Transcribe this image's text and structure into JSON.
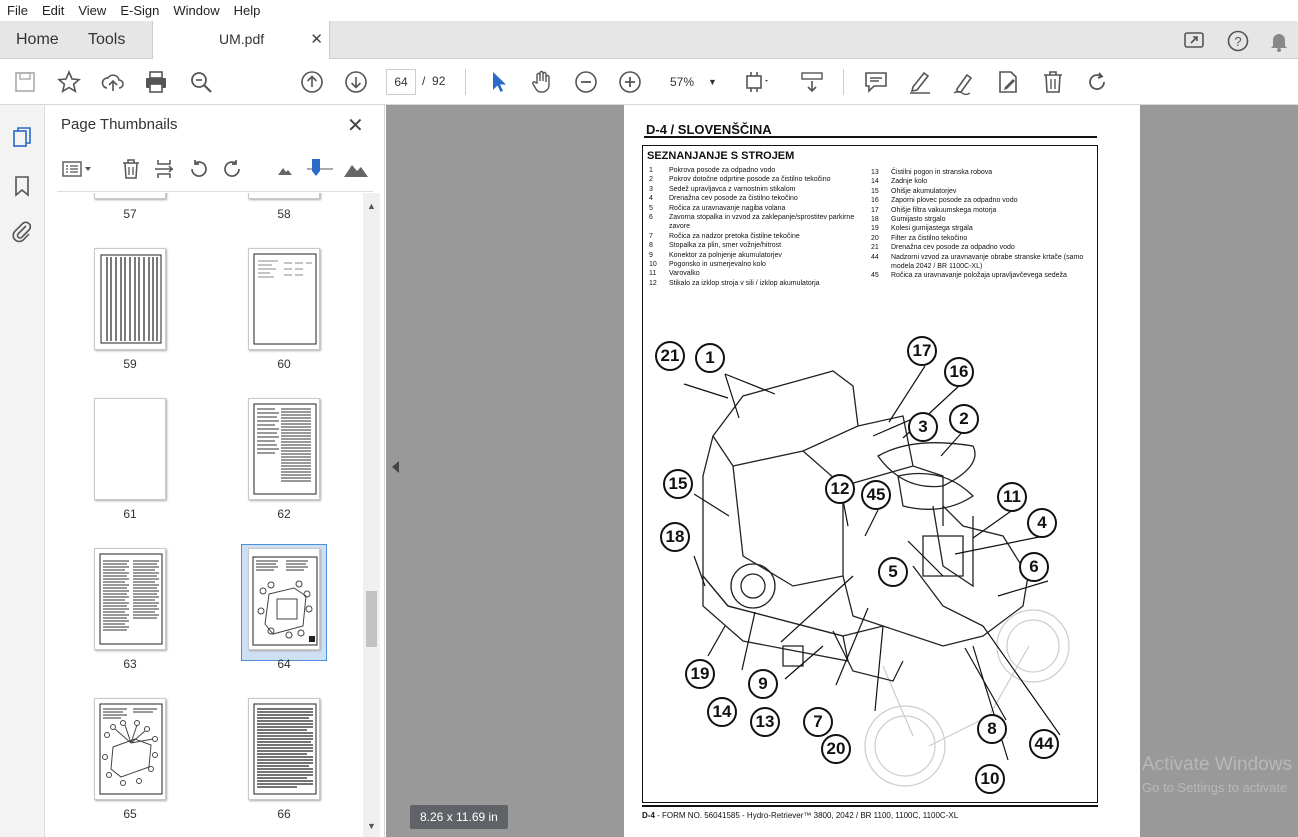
{
  "menu": [
    "File",
    "Edit",
    "View",
    "E-Sign",
    "Window",
    "Help"
  ],
  "tabs": {
    "home": "Home",
    "tools": "Tools",
    "document": "UM.pdf"
  },
  "toolbar": {
    "current_page": "64",
    "page_separator": "/",
    "total_pages": "92",
    "zoom": "57%"
  },
  "thumbnail_panel": {
    "title": "Page Thumbnails",
    "pages": [
      "57",
      "58",
      "59",
      "60",
      "61",
      "62",
      "63",
      "64",
      "65",
      "66"
    ],
    "selected_page": "64"
  },
  "page": {
    "header": "D-4 / SLOVENŠČINA",
    "section_title": "SEZNANJANJE S STROJEM",
    "legend_left": [
      {
        "n": "1",
        "t": "Pokrova posode za odpadno vodo"
      },
      {
        "n": "2",
        "t": "Pokrov dotočne odprtine posode za čistilno tekočino"
      },
      {
        "n": "3",
        "t": "Sedež upravljavca z varnostnim stikalom"
      },
      {
        "n": "4",
        "t": "Drenažna cev posode za čistilno tekočino"
      },
      {
        "n": "5",
        "t": "Ročica za uravnavanje nagiba volana"
      },
      {
        "n": "6",
        "t": "Zavorna stopalka in vzvod za zaklepanje/sprostitev parkirne zavore"
      },
      {
        "n": "7",
        "t": "Ročica za nadzor pretoka čistilne tekočine"
      },
      {
        "n": "8",
        "t": "Stopalka za plin, smer vožnje/hitrost"
      },
      {
        "n": "9",
        "t": "Konektor za polnjenje akumulatorjev"
      },
      {
        "n": "10",
        "t": "Pogonsko in usmerjevalno kolo"
      },
      {
        "n": "11",
        "t": "Varovalko"
      },
      {
        "n": "12",
        "t": "Stikalo za izklop stroja v sili / izklop akumulatorja"
      }
    ],
    "legend_right": [
      {
        "n": "13",
        "t": "Čistilni pogon in stranska robova"
      },
      {
        "n": "14",
        "t": "Zadnje kolo"
      },
      {
        "n": "15",
        "t": "Ohišje akumulatorjev"
      },
      {
        "n": "16",
        "t": "Zaporni plovec posode za odpadno vodo"
      },
      {
        "n": "17",
        "t": "Ohišje filtra vakuumskega motorja"
      },
      {
        "n": "18",
        "t": "Gumijasto strgalo"
      },
      {
        "n": "19",
        "t": "Kolesi gumijastega strgala"
      },
      {
        "n": "20",
        "t": "Filter za čistilno tekočino"
      },
      {
        "n": "21",
        "t": "Drenažna cev posode za odpadno vodo"
      },
      {
        "n": "44",
        "t": "Nadzorni vzvod za uravnavanje obrabe stranske krtače (samo modela 2042 / BR 1100C-XL)"
      },
      {
        "n": "45",
        "t": "Ročica za uravnavanje položaja upravljavčevega sedeža"
      }
    ],
    "callouts": [
      "21",
      "1",
      "17",
      "16",
      "3",
      "2",
      "15",
      "12",
      "45",
      "11",
      "4",
      "18",
      "5",
      "6",
      "19",
      "9",
      "14",
      "13",
      "7",
      "20",
      "8",
      "44",
      "10"
    ],
    "footer_prefix": "D-4",
    "footer": "- FORM NO. 56041585 - Hydro-Retriever™ 3800, 2042 / BR 1100, 1100C, 1100C-XL"
  },
  "page_size_badge": "8.26 x 11.69 in",
  "watermark": {
    "line1": "Activate Windows",
    "line2": "Go to Settings to activate"
  }
}
